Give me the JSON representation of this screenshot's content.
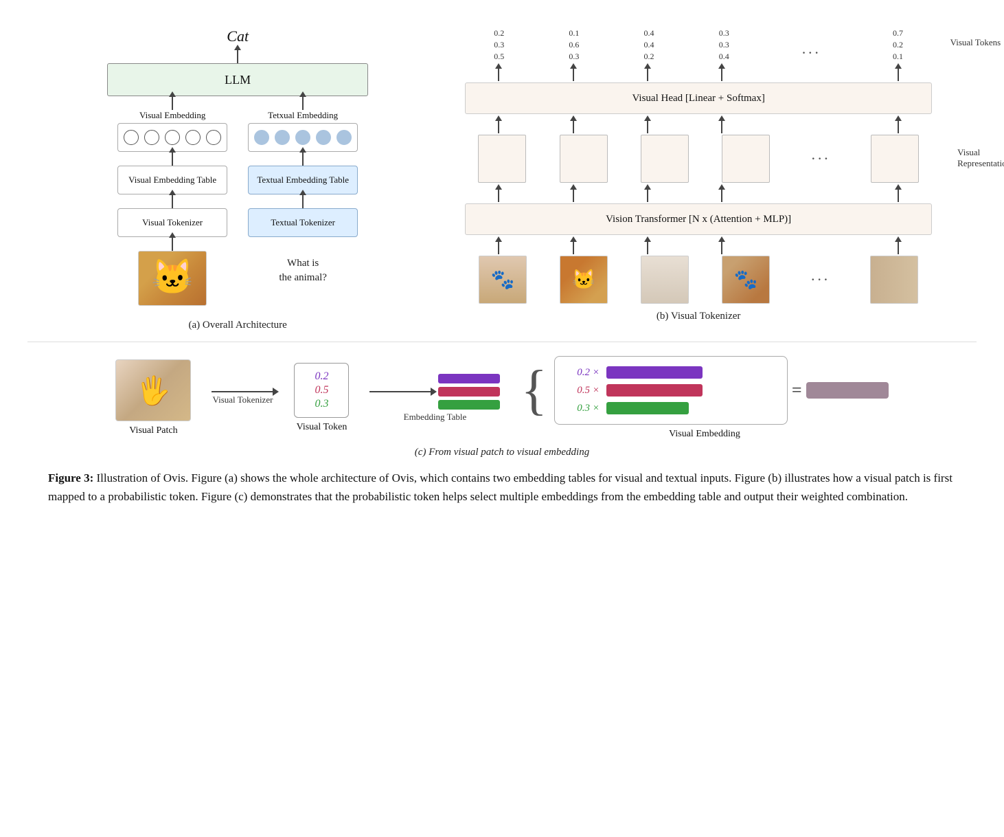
{
  "figure": {
    "title": "Figure 3:",
    "caption_bold": "Figure 3:",
    "caption_text": " Illustration of Ovis. Figure (a) shows the whole architecture of Ovis, which contains two embedding tables for visual and textual inputs. Figure (b) illustrates how a visual patch is first mapped to a probabilistic token. Figure (c) demonstrates that the probabilistic token helps select multiple embeddings from the embedding table and output their weighted combination.",
    "diagrams": {
      "a": {
        "label": "(a) Overall Architecture",
        "output_label": "Cat",
        "llm_label": "LLM",
        "visual_embed_label": "Visual Embedding",
        "textual_embed_label": "Tetxual Embedding",
        "visual_table_label": "Visual Embedding Table",
        "textual_table_label": "Textual Embedding Table",
        "visual_tokenizer_label": "Visual Tokenizer",
        "textual_tokenizer_label": "Textual Tokenizer",
        "question_text": "What is\nthe animal?"
      },
      "b": {
        "label": "(b) Visual Tokenizer",
        "visual_head_label": "Visual Head [Linear + Softmax]",
        "vit_label": "Vision Transformer [N x (Attention + MLP)]",
        "visual_tokens_label": "Visual Tokens",
        "visual_reps_label": "Visual\nRepresentations",
        "token_values": [
          {
            "v1": "0.2",
            "v2": "0.3",
            "v3": "0.5"
          },
          {
            "v1": "0.1",
            "v2": "0.6",
            "v3": "0.3"
          },
          {
            "v1": "0.4",
            "v2": "0.4",
            "v3": "0.2"
          },
          {
            "v1": "0.3",
            "v2": "0.3",
            "v3": "0.4"
          },
          {
            "v1": "0.7",
            "v2": "0.2",
            "v3": "0.1"
          }
        ]
      },
      "c": {
        "label": "(c) From visual patch to visual embedding",
        "visual_patch_label": "Visual Patch",
        "visual_token_label": "Visual Token",
        "embedding_table_label": "Embedding Table",
        "visual_embedding_label": "Visual Embedding",
        "token_vals": {
          "purple": "0.2",
          "red": "0.5",
          "green": "0.3"
        },
        "result_vals": {
          "purple": "0.2 ×",
          "red": "0.5 ×",
          "green": "0.3 ×"
        }
      }
    }
  }
}
